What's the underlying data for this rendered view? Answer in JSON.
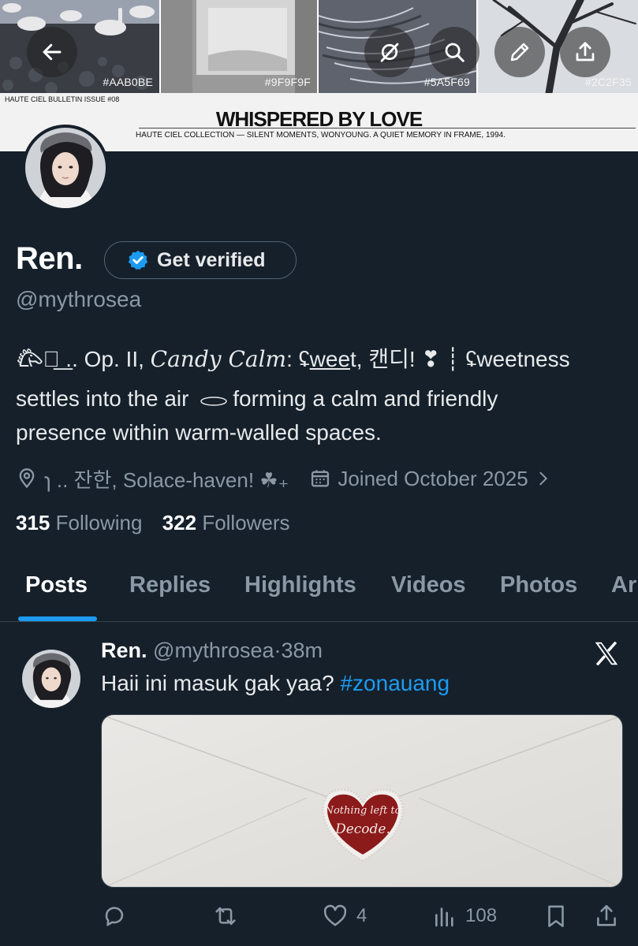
{
  "banner": {
    "swatches": [
      "#AAB0BE",
      "#9F9F9F",
      "#5A5F69",
      "#2C2F35"
    ],
    "bulletin": "HAUTE CIEL BULLETIN ISSUE #08",
    "title": "WHISPERED BY LOVE",
    "subtitle": "HAUTE CIEL COLLECTION — SILENT MOMENTS, WONYOUNG. A QUIET MEMORY IN FRAME, 1994."
  },
  "header_buttons": {
    "back": "back-arrow-icon",
    "grok": "grok-icon",
    "search": "search-icon",
    "edit": "pencil-icon",
    "share": "share-icon"
  },
  "profile": {
    "name": "Ren.",
    "verify_label": "Get verified",
    "handle": "@mythrosea",
    "bio": {
      "line1_prefix": "𐂃ิ͟ .. Op. II, ",
      "line1_script": "Candy Calm",
      "line1_colon": ": ʢ",
      "line1_wee": "wee",
      "line1_rest": "t, 캔디! ❣ ┊ ʢweetness",
      "line2_a": "settles into the air",
      "line2_b": "forming a calm and friendly",
      "line3": "presence within warm-walled spaces."
    },
    "location": "ɿ .. 잔한, Solace-haven! ☘︎₊",
    "joined": "Joined October 2025",
    "following_count": "315",
    "following_label": "Following",
    "followers_count": "322",
    "followers_label": "Followers"
  },
  "tabs": [
    "Posts",
    "Replies",
    "Highlights",
    "Videos",
    "Photos",
    "Ar"
  ],
  "post": {
    "author": "Ren.",
    "handle": "@mythrosea",
    "dot": "·",
    "time": "38m",
    "text": "Haii ini masuk gak yaa?",
    "hashtag": "#zonauang",
    "seal_text_1": "Nothing left to",
    "seal_text_2": "Decode.",
    "actions": {
      "reply_count": "",
      "repost_count": "",
      "like_count": "4",
      "views_count": "108"
    }
  },
  "colors": {
    "background": "#15202b",
    "accent": "#1d9bf0",
    "muted": "#8b98a5",
    "seal": "#8b1a1a"
  }
}
